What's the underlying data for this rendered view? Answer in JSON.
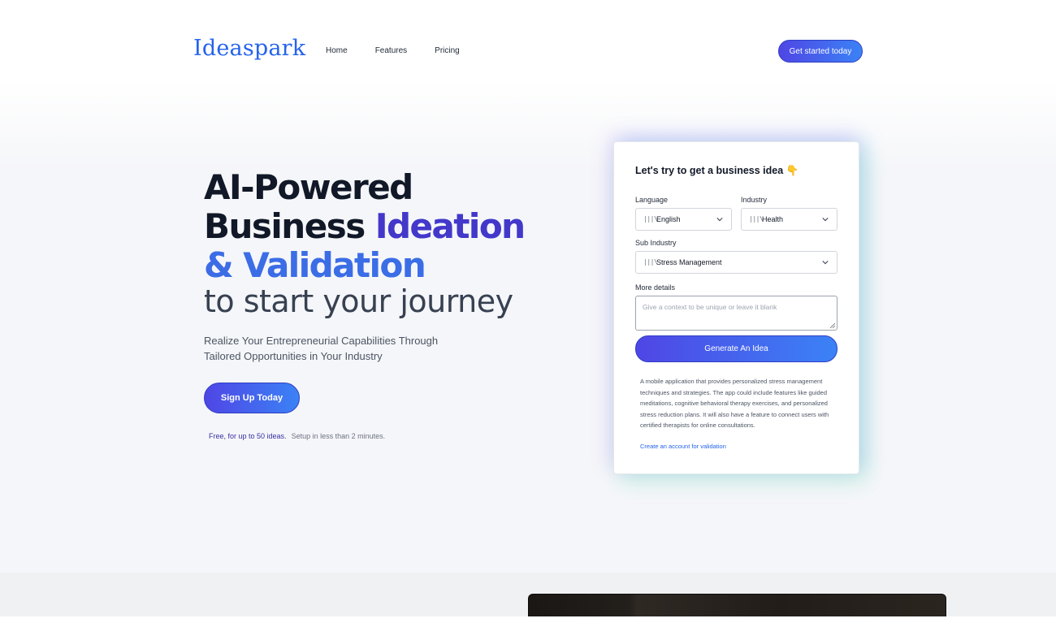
{
  "header": {
    "logo": "Ideaspark",
    "nav": [
      "Home",
      "Features",
      "Pricing"
    ],
    "cta": "Get started today"
  },
  "hero": {
    "line1": "AI-Powered",
    "line2_a": "Business ",
    "line2_b": "Ideation",
    "line3": "& Validation",
    "line4": "to start your journey",
    "desc": "Realize Your Entrepreneurial Capabilities Through Tailored Opportunities in Your Industry",
    "signup": "Sign Up Today",
    "note_highlight": "Free, for up to 50 ideas.",
    "note_muted": "Setup in less than 2 minutes."
  },
  "form": {
    "title": "Let's try to get a business idea 👇",
    "language_label": "Language",
    "language_value": "English",
    "industry_label": "Industry",
    "industry_value": "Health",
    "subindustry_label": "Sub Industry",
    "subindustry_value": "Stress Management",
    "details_label": "More details",
    "details_placeholder": "Give a context to be unique or leave it blank",
    "generate": "Generate An Idea",
    "result": "A mobile application that provides personalized stress management techniques and strategies. The app could include features like guided meditations, cognitive behavioral therapy exercises, and personalized stress reduction plans. It will also have a feature to connect users with certified therapists for online consultations.",
    "result_link": "Create an account for validation"
  },
  "colors": {
    "brand": "#2563eb",
    "accent_indigo": "#4338ca",
    "button_gradient_start": "#4f46e5",
    "button_gradient_end": "#3b82f6"
  }
}
